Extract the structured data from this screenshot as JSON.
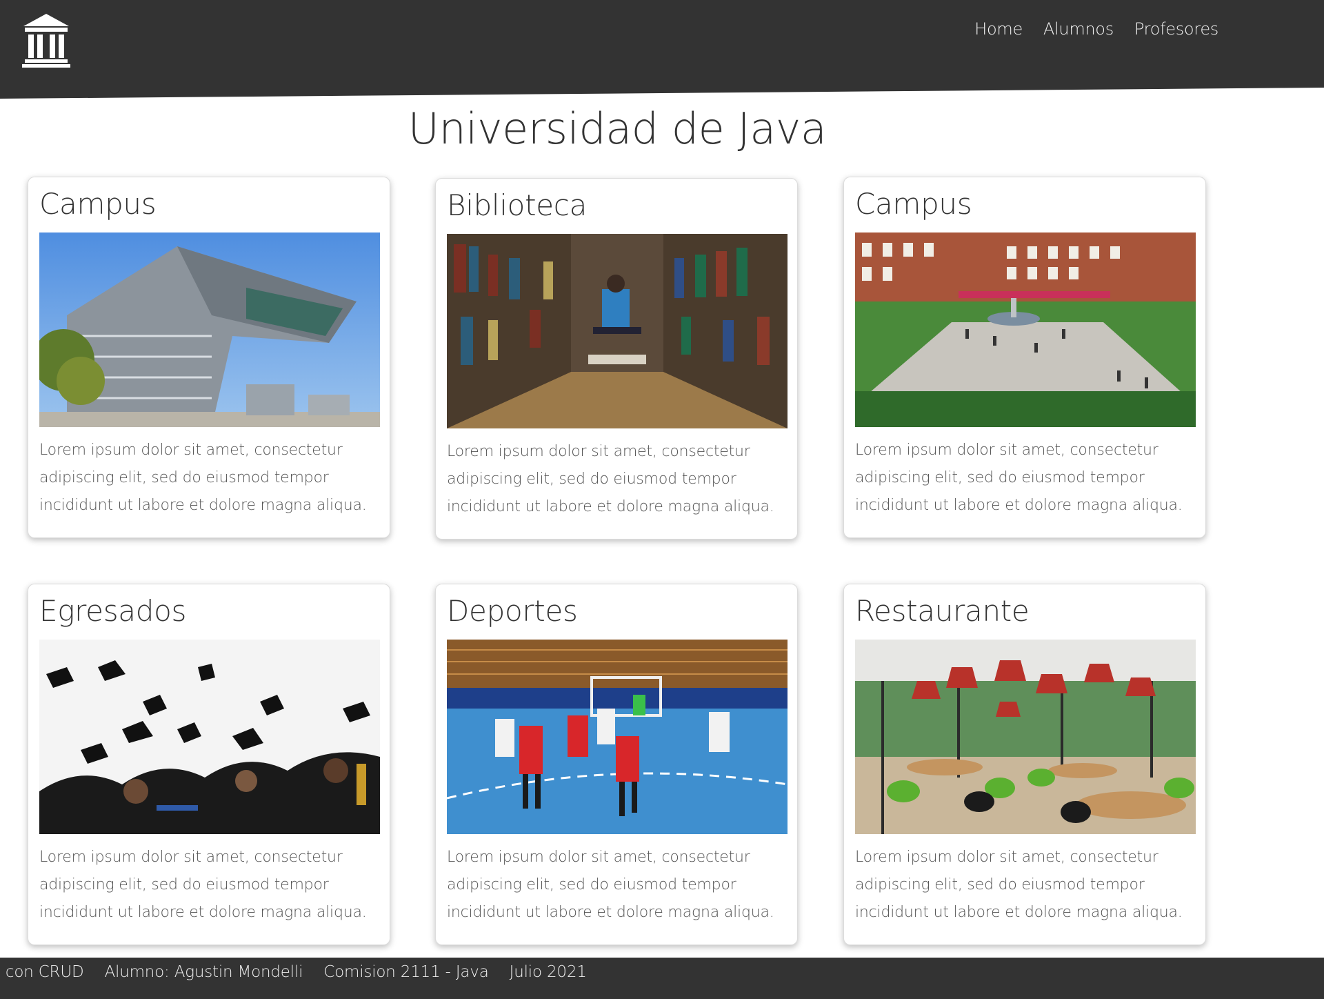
{
  "header": {
    "nav": [
      {
        "label": "Home"
      },
      {
        "label": "Alumnos"
      },
      {
        "label": "Profesores"
      }
    ]
  },
  "page": {
    "title": "Universidad de Java"
  },
  "cards": [
    {
      "title": "Campus",
      "text": "Lorem ipsum dolor sit amet, consectetur adipiscing elit, sed do eiusmod tempor incididunt ut labore et dolore magna aliqua."
    },
    {
      "title": "Biblioteca",
      "text": "Lorem ipsum dolor sit amet, consectetur adipiscing elit, sed do eiusmod tempor incididunt ut labore et dolore magna aliqua."
    },
    {
      "title": "Campus",
      "text": "Lorem ipsum dolor sit amet, consectetur adipiscing elit, sed do eiusmod tempor incididunt ut labore et dolore magna aliqua."
    },
    {
      "title": "Egresados",
      "text": "Lorem ipsum dolor sit amet, consectetur adipiscing elit, sed do eiusmod tempor incididunt ut labore et dolore magna aliqua."
    },
    {
      "title": "Deportes",
      "text": "Lorem ipsum dolor sit amet, consectetur adipiscing elit, sed do eiusmod tempor incididunt ut labore et dolore magna aliqua."
    },
    {
      "title": "Restaurante",
      "text": "Lorem ipsum dolor sit amet, consectetur adipiscing elit, sed do eiusmod tempor incididunt ut labore et dolore magna aliqua."
    }
  ],
  "footer": {
    "items": [
      "nd con CRUD",
      "Alumno: Agustin Mondelli",
      "Comision 2111 - Java",
      "Julio 2021"
    ]
  },
  "colors": {
    "header_bg": "#333333",
    "footer_bg": "#333333",
    "page_bg": "#ffffff"
  }
}
